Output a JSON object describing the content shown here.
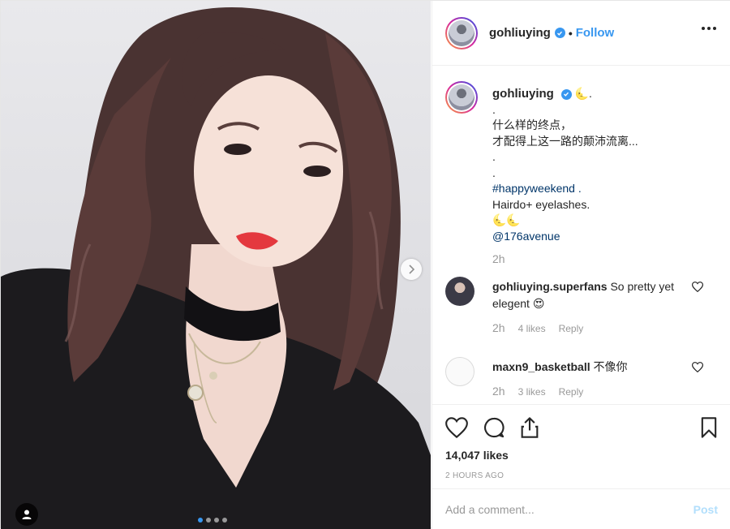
{
  "header": {
    "username": "gohliuying",
    "separator": "•",
    "follow_label": "Follow",
    "more_icon": "more-options-icon"
  },
  "caption": {
    "username": "gohliuying",
    "lines": [
      "🌜.",
      ".",
      "什么样的终点，",
      "才配得上这一路的颠沛流离...",
      ".",
      ".",
      "#happyweekend .",
      "Hairdo+ eyelashes.",
      "🌜🌜",
      "@176avenue"
    ],
    "time": "2h"
  },
  "comments": [
    {
      "username": "gohliuying.superfans",
      "text": "So pretty yet elegent 😍",
      "time": "2h",
      "likes": "4 likes",
      "reply": "Reply"
    },
    {
      "username": "maxn9_basketball",
      "text": "不像你",
      "time": "2h",
      "likes": "3 likes",
      "reply": "Reply"
    }
  ],
  "actions": {
    "likes_count": "14,047 likes",
    "posted_ago": "2 HOURS AGO"
  },
  "add_comment": {
    "placeholder": "Add a comment...",
    "post_label": "Post"
  },
  "carousel": {
    "slides": 4,
    "active": 1
  },
  "colors": {
    "accent": "#3897f0",
    "link": "#003569",
    "muted": "#999999",
    "post_disabled": "#b2dffc"
  }
}
